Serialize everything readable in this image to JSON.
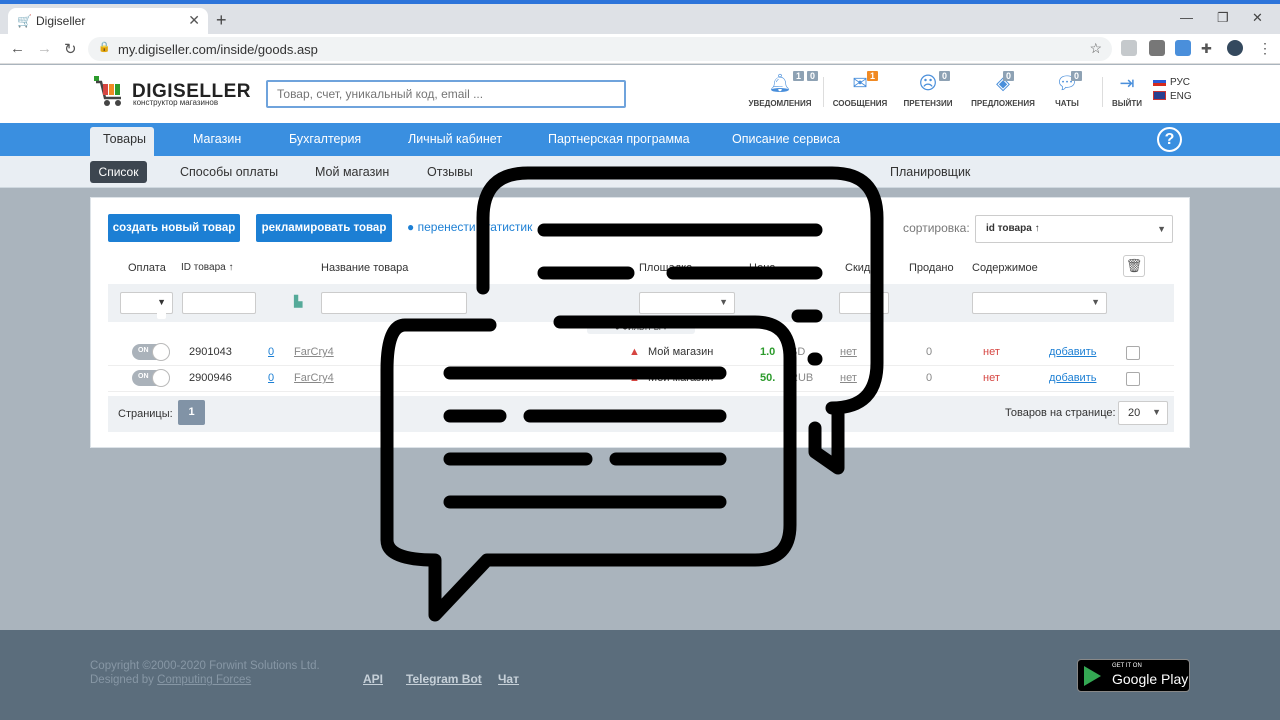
{
  "browser": {
    "tab_title": "Digiseller",
    "url": "my.digiseller.com/inside/goods.asp"
  },
  "header": {
    "logo_title": "DIGISELLER",
    "logo_subtitle": "конструктор магазинов",
    "search_placeholder": "Товар, счет, уникальный код, email ...",
    "icons": [
      {
        "name": "bell-icon",
        "label": "уведомления",
        "count_a": "1",
        "count_b": "0"
      },
      {
        "name": "envelope-icon",
        "label": "сообщения",
        "count": "1"
      },
      {
        "name": "sad-face-icon",
        "label": "претензии",
        "count": "0"
      },
      {
        "name": "tag-icon",
        "label": "предложения",
        "count": "0"
      },
      {
        "name": "chat-icon",
        "label": "чаты",
        "count": "0"
      },
      {
        "name": "logout-icon",
        "label": "выйти"
      }
    ],
    "lang_ru": "РУС",
    "lang_en": "ENG"
  },
  "topnav": [
    "Товары",
    "Магазин",
    "Бухгалтерия",
    "Личный кабинет",
    "Партнерская программа",
    "Описание сервиса"
  ],
  "subnav": [
    "Список",
    "Способы оплаты",
    "Мой магазин",
    "Отзывы",
    "Планировщик"
  ],
  "panel": {
    "create_btn": "создать новый товар",
    "advertise_btn": "рекламировать товар",
    "move_stats": "перенести статистик",
    "sort_label": "сортировка:",
    "sort_value": "id товара ↑",
    "columns": {
      "payment": "Оплата",
      "id": "ID товара ↑",
      "name": "Название товара",
      "platform": "Площадка",
      "price": "Цена",
      "discount": "Скид",
      "sold": "Продано",
      "content": "Содержимое"
    },
    "filters_label": "● ФИЛЬТРЫ ▾",
    "rows": [
      {
        "toggle": "ON",
        "id": "2901043",
        "count": "0",
        "name": "FarCry4",
        "platform": "Мой магазин",
        "price": "1.0",
        "currency": "SD",
        "discount": "нет",
        "sold": "0",
        "content": "нет",
        "add": "добавить"
      },
      {
        "toggle": "ON",
        "id": "2900946",
        "count": "0",
        "name": "FarCry4",
        "platform": "Мой магазин",
        "price": "50.",
        "currency": "RUB",
        "discount": "нет",
        "sold": "0",
        "content": "нет",
        "add": "добавить"
      }
    ],
    "pages_label": "Страницы:",
    "page": "1",
    "per_page_label": "Товаров на странице:",
    "per_page": "20"
  },
  "footer": {
    "copyright": "Copyright ©2000-2020 Forwint Solutions Ltd.",
    "designed_by": "Designed by",
    "designer": "Computing Forces",
    "links": [
      "API",
      "Telegram Bot",
      "Чат"
    ],
    "gplay_small": "GET IT ON",
    "gplay_big": "Google Play"
  },
  "colors": {
    "accent": "#3a8fe0",
    "button": "#1c7fd4",
    "footer": "#5b6d7c"
  }
}
